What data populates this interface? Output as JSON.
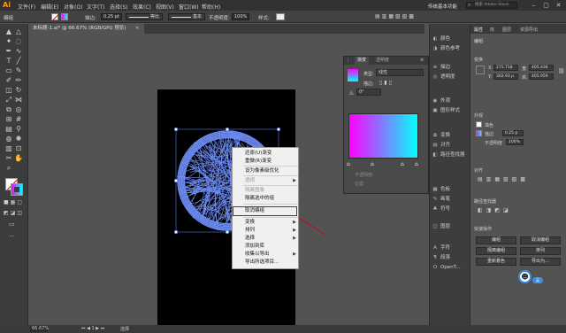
{
  "app": {
    "logo": "Ai",
    "menu": [
      "文件(F)",
      "编辑(E)",
      "对象(O)",
      "文字(T)",
      "选择(S)",
      "效果(C)",
      "视图(V)",
      "窗口(W)",
      "帮助(H)"
    ],
    "workspace": "传统基本功能",
    "search_placeholder": "搜索 Adobe Stock"
  },
  "control_bar": {
    "object_label": "编组",
    "stroke_label": "描边:",
    "stroke_value": "0.25 pt",
    "line_style": "等比",
    "brush": "基本",
    "opacity_label": "不透明度:",
    "opacity_value": "100%",
    "style_label": "样式:"
  },
  "document": {
    "tab_title": "未标题-1.ai* @ 66.67% (RGB/GPU 预览)",
    "zoom": "66.67%",
    "status_tool": "选择"
  },
  "gradient_panel": {
    "tabs": [
      "渐变",
      "透明度"
    ],
    "type_label": "类型:",
    "type_value": "线性",
    "stroke_label": "描边:",
    "angle_value": "0°",
    "colors": {
      "start": "#ff00ff",
      "end": "#00ffff"
    },
    "opacity_label": "不透明度:",
    "location_label": "位置:"
  },
  "context_menu": {
    "items": [
      {
        "label": "还原(U)渐变",
        "disabled": false,
        "submenu": false
      },
      {
        "label": "重做(R)渐变",
        "disabled": false,
        "submenu": false
      },
      {
        "label": "设为像素级优化",
        "disabled": false,
        "submenu": false
      },
      {
        "label": "透视",
        "disabled": true,
        "submenu": true
      },
      {
        "label": "隔离图像",
        "disabled": true,
        "submenu": false
      },
      {
        "label": "隔离选中的组",
        "disabled": false,
        "submenu": false
      },
      {
        "label": "取消编组",
        "disabled": false,
        "submenu": false
      },
      {
        "label": "变换",
        "disabled": false,
        "submenu": true
      },
      {
        "label": "排列",
        "disabled": false,
        "submenu": true
      },
      {
        "label": "选择",
        "disabled": false,
        "submenu": true
      },
      {
        "label": "添加到库",
        "disabled": false,
        "submenu": false
      },
      {
        "label": "收集以导出",
        "disabled": false,
        "submenu": true
      },
      {
        "label": "导出所选项目...",
        "disabled": false,
        "submenu": false
      }
    ],
    "highlighted": "取消编组",
    "highlight_color": "#d0021b"
  },
  "dock": {
    "items": [
      {
        "icon": "swatch-icon",
        "label": "颜色"
      },
      {
        "icon": "color-guide-icon",
        "label": "颜色参考"
      },
      {
        "icon": "stroke-icon",
        "label": "描边"
      },
      {
        "icon": "transparency-icon",
        "label": "透明度"
      },
      {
        "icon": "appearance-icon",
        "label": "外观"
      },
      {
        "icon": "graphic-styles-icon",
        "label": "图形样式"
      },
      {
        "icon": "transform-icon",
        "label": "变换"
      },
      {
        "icon": "align-icon",
        "label": "对齐"
      },
      {
        "icon": "pathfinder-icon",
        "label": "路径查找器"
      },
      {
        "icon": "swatches-icon",
        "label": "色板"
      },
      {
        "icon": "brushes-icon",
        "label": "画笔"
      },
      {
        "icon": "symbols-icon",
        "label": "符号"
      },
      {
        "icon": "layers-icon",
        "label": "图层"
      },
      {
        "icon": "character-icon",
        "label": "字符"
      },
      {
        "icon": "paragraph-icon",
        "label": "段落"
      },
      {
        "icon": "opentype-icon",
        "label": "OpenT..."
      }
    ]
  },
  "properties": {
    "tabs": [
      "属性",
      "库",
      "图层",
      "资源导出"
    ],
    "group_title": "编组",
    "transform_title": "变换",
    "x_label": "X:",
    "x_value": "275.718",
    "y_label": "Y:",
    "y_value": "302.93 p",
    "w_label": "宽:",
    "w_value": "405.436",
    "h_label": "高:",
    "h_value": "405.959",
    "appearance_title": "外观",
    "fill_label": "填色",
    "stroke_label": "描边",
    "stroke_value": "0.25 p",
    "opacity_label": "不透明度",
    "opacity_value": "100%",
    "align_title": "对齐",
    "path_title": "路径查找器",
    "quick_title": "快速操作",
    "btn_group": "编组",
    "btn_isolate": "取消编组",
    "btn_recolor": "隔离编组",
    "btn_arrange": "排列",
    "btn_recolor2": "重新着色",
    "btn_export": "导出为..."
  },
  "toolbar": {
    "tools": [
      "selection-icon",
      "direct-selection-icon",
      "magic-wand-icon",
      "lasso-icon",
      "pen-icon",
      "curvature-icon",
      "type-icon",
      "line-icon",
      "rectangle-icon",
      "paintbrush-icon",
      "shaper-icon",
      "pencil-icon",
      "eraser-icon",
      "rotate-icon",
      "scale-icon",
      "width-icon",
      "free-transform-icon",
      "shape-builder-icon",
      "perspective-icon",
      "mesh-icon",
      "gradient-icon",
      "eyedropper-icon",
      "blend-icon",
      "symbol-sprayer-icon",
      "graph-icon",
      "artboard-icon",
      "slice-icon",
      "hand-icon",
      "zoom-icon"
    ]
  }
}
